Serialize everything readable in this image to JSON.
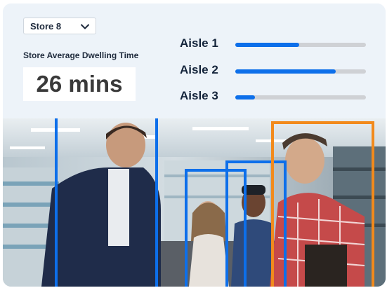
{
  "store_selector": {
    "selected": "Store 8",
    "icon": "chevron-down-icon"
  },
  "dwelling": {
    "label": "Store Average Dwelling Time",
    "value": "26 mins"
  },
  "aisles": [
    {
      "label": "Aisle 1",
      "fill_fraction": 0.49
    },
    {
      "label": "Aisle 2",
      "fill_fraction": 0.77
    },
    {
      "label": "Aisle 3",
      "fill_fraction": 0.15
    }
  ],
  "colors": {
    "accent_blue": "#0d6fea",
    "detection_orange": "#f28a1c",
    "track_gray": "#cfd1d5"
  },
  "camera_feed": {
    "detection_boxes": [
      {
        "color": "blue"
      },
      {
        "color": "blue"
      },
      {
        "color": "blue"
      },
      {
        "color": "orange"
      }
    ]
  }
}
